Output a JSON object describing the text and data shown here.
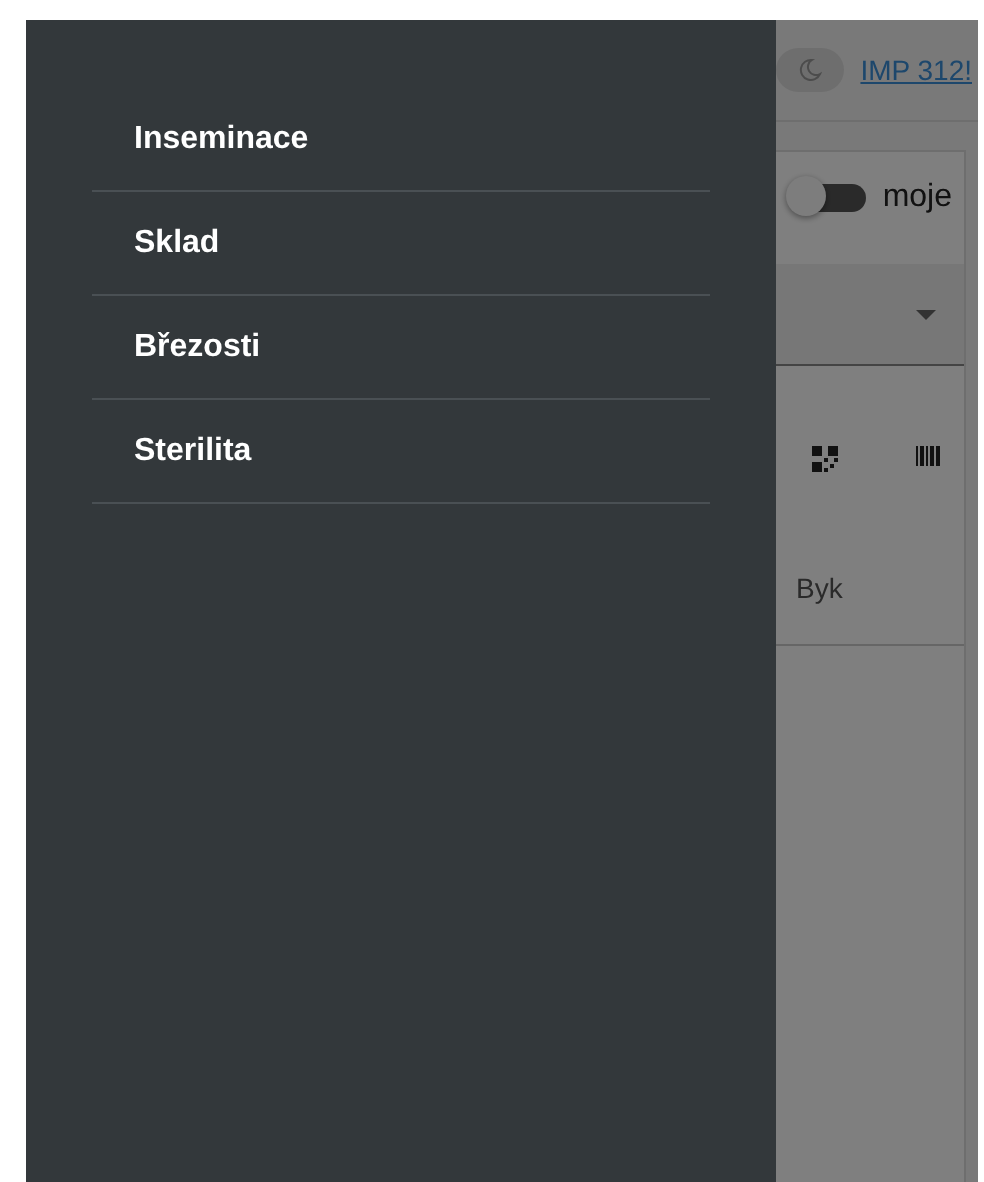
{
  "drawer": {
    "items": [
      {
        "label": "Inseminace"
      },
      {
        "label": "Sklad"
      },
      {
        "label": "Březosti"
      },
      {
        "label": "Sterilita"
      }
    ]
  },
  "background": {
    "header": {
      "dark_mode": false,
      "link": "IMP 312!"
    },
    "filter": {
      "toggle_label": "moje",
      "on": false
    },
    "table": {
      "columns": [
        "Byk"
      ]
    }
  }
}
